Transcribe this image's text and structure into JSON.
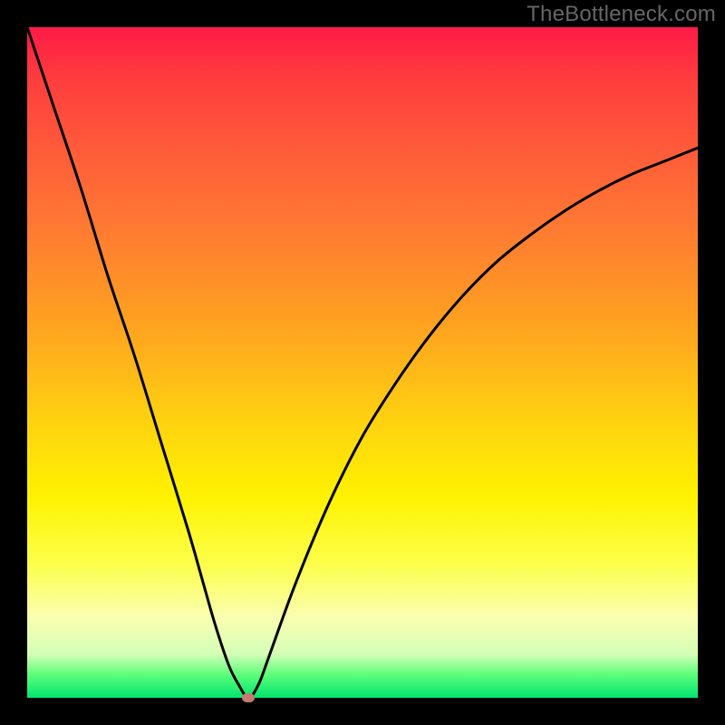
{
  "watermark": "TheBottleneck.com",
  "chart_data": {
    "type": "line",
    "title": "",
    "xlabel": "",
    "ylabel": "",
    "xlim": [
      0,
      100
    ],
    "ylim": [
      0,
      100
    ],
    "grid": false,
    "legend": false,
    "series": [
      {
        "name": "bottleneck-curve",
        "x": [
          0,
          4,
          8,
          12,
          16,
          20,
          24,
          26,
          28,
          30,
          31.5,
          33,
          34.5,
          36,
          40,
          45,
          50,
          55,
          60,
          65,
          70,
          75,
          80,
          85,
          90,
          95,
          100
        ],
        "y": [
          100,
          88,
          76,
          63,
          51,
          38,
          25,
          18,
          11,
          5,
          2,
          0,
          2,
          6,
          17,
          29,
          39,
          47,
          54,
          60,
          65,
          69,
          72.5,
          75.5,
          78,
          80,
          82
        ]
      }
    ],
    "marker": {
      "x": 33,
      "y": 0,
      "shape": "rounded-rect",
      "color": "#c47a6f"
    },
    "background_gradient": {
      "top": "#ff1a46",
      "mid": "#fff200",
      "bottom": "#00e46f"
    }
  }
}
